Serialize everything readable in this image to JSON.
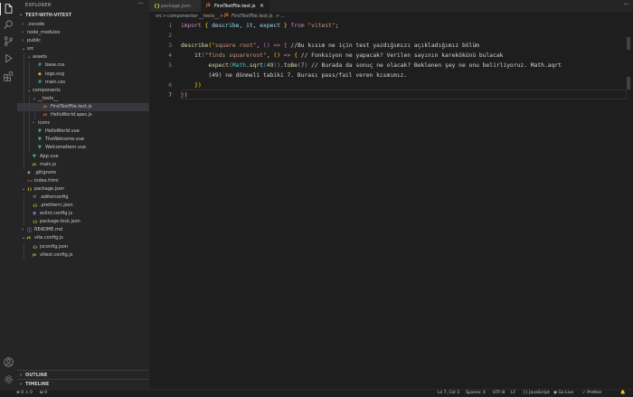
{
  "activity_bar": {
    "items": [
      {
        "name": "explorer",
        "icon": "files-icon",
        "active": true
      },
      {
        "name": "search",
        "icon": "search-icon"
      },
      {
        "name": "source-control",
        "icon": "source-control-icon"
      },
      {
        "name": "run-debug",
        "icon": "run-debug-icon"
      },
      {
        "name": "extensions",
        "icon": "extensions-icon"
      }
    ],
    "bottom": [
      {
        "name": "accounts",
        "icon": "account-icon"
      },
      {
        "name": "manage",
        "icon": "gear-icon"
      }
    ]
  },
  "sidebar": {
    "title": "EXPLORER",
    "more": "···",
    "project": "TEST-WITH-VITEST",
    "tree": [
      {
        "label": ".vscode",
        "type": "folder",
        "depth": 0,
        "open": false
      },
      {
        "label": "node_modules",
        "type": "folder",
        "depth": 0,
        "open": false
      },
      {
        "label": "public",
        "type": "folder",
        "depth": 0,
        "open": false
      },
      {
        "label": "src",
        "type": "folder",
        "depth": 0,
        "open": true
      },
      {
        "label": "assets",
        "type": "folder",
        "depth": 1,
        "open": true
      },
      {
        "label": "base.css",
        "type": "css",
        "depth": 2
      },
      {
        "label": "logo.svg",
        "type": "svg",
        "depth": 2
      },
      {
        "label": "main.css",
        "type": "css",
        "depth": 2
      },
      {
        "label": "components",
        "type": "folder",
        "depth": 1,
        "open": true
      },
      {
        "label": "__tests__",
        "type": "folder",
        "depth": 2,
        "open": true
      },
      {
        "label": "FirstTestFile.test.js",
        "type": "test",
        "depth": 3,
        "selected": true
      },
      {
        "label": "HelloWorld.spec.js",
        "type": "test",
        "depth": 3
      },
      {
        "label": "icons",
        "type": "folder",
        "depth": 2,
        "open": false
      },
      {
        "label": "HelloWorld.vue",
        "type": "vue",
        "depth": 2
      },
      {
        "label": "TheWelcome.vue",
        "type": "vue",
        "depth": 2
      },
      {
        "label": "WelcomeItem.vue",
        "type": "vue",
        "depth": 2
      },
      {
        "label": "App.vue",
        "type": "vue",
        "depth": 1
      },
      {
        "label": "main.js",
        "type": "js",
        "depth": 1
      },
      {
        "label": ".gitignore",
        "type": "git",
        "depth": 0
      },
      {
        "label": "index.html",
        "type": "html",
        "depth": 0
      },
      {
        "label": "package.json",
        "type": "json-group",
        "depth": 0,
        "open": true
      },
      {
        "label": ".editorconfig",
        "type": "gear",
        "depth": 1
      },
      {
        "label": ".prettierrc.json",
        "type": "json",
        "depth": 1
      },
      {
        "label": "eslint.config.js",
        "type": "eslint",
        "depth": 1
      },
      {
        "label": "package-lock.json",
        "type": "json",
        "depth": 1
      },
      {
        "label": "README.md",
        "type": "md",
        "depth": 0,
        "open": false
      },
      {
        "label": "vite.config.js",
        "type": "js-group",
        "depth": 0,
        "open": true
      },
      {
        "label": "jsconfig.json",
        "type": "json",
        "depth": 1
      },
      {
        "label": "vitest.config.js",
        "type": "js",
        "depth": 1
      }
    ],
    "sections": [
      {
        "label": "OUTLINE"
      },
      {
        "label": "TIMELINE"
      }
    ]
  },
  "tabs": [
    {
      "label": "package.json",
      "icon_text": "{}",
      "icon_color": "#cbcb41",
      "active": false
    },
    {
      "label": "FirstTestFile.test.js",
      "icon_text": "JS",
      "icon_color": "#e37933",
      "active": true,
      "close": "×"
    }
  ],
  "tab_actions": "···",
  "breadcrumb": [
    "src",
    ">",
    "components",
    ">",
    "__tests__",
    ">",
    "JS",
    "FirstTestFile.test.js",
    ">",
    "..."
  ],
  "editor": {
    "line_numbers": [
      "1",
      "2",
      "3",
      "4",
      "5",
      "",
      "6",
      "7"
    ],
    "current_line": "7"
  },
  "status_bar": {
    "problems": "⊗ 0 ⚠ 0",
    "ports": "⛁ 0",
    "cursor": "Ln 7, Col 3",
    "spaces": "Spaces: 4",
    "encoding": "UTF-8",
    "eol": "LF",
    "language": "{} JavaScript",
    "golive": "◉ Go Live",
    "prettier": "✓ Prettier",
    "bell": "🔔"
  },
  "colors": {
    "accent": "#007acc",
    "vue": "#41b883",
    "js": "#e37933",
    "json": "#cbcb41",
    "css": "#519aba"
  }
}
